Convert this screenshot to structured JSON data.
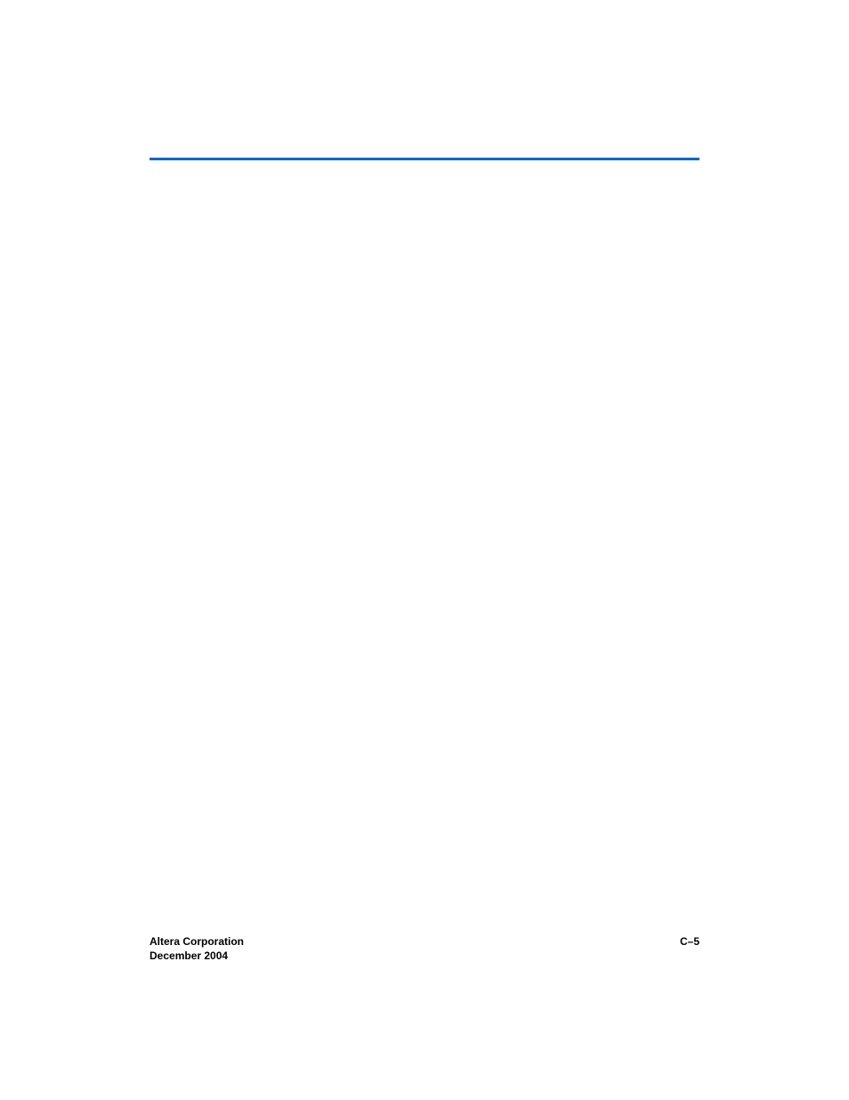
{
  "footer": {
    "company": "Altera Corporation",
    "date": "December 2004",
    "page_number": "C–5"
  }
}
